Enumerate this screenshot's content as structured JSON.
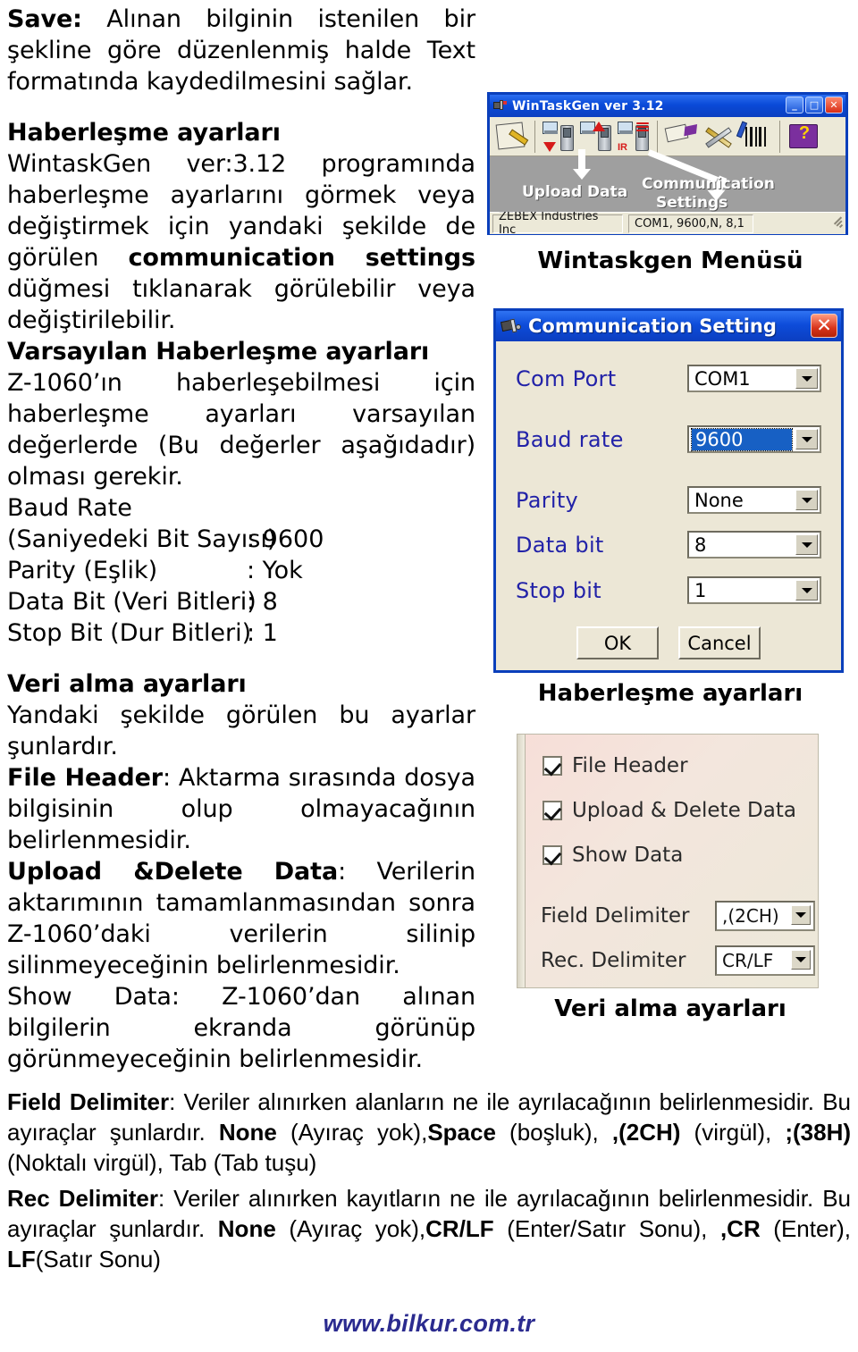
{
  "document": {
    "save_section": {
      "term": "Save:",
      "text": " Alınan bilginin istenilen bir şekline göre düzenlenmiş halde Text formatında kaydedilmesini sağlar."
    },
    "comm_heading": "Haberleşme ayarları",
    "comm_p1_a": "WintaskGen ver:3.12 programında haberleşme ayarlarını görmek veya değiştirmek için yandaki şekilde de görülen ",
    "comm_p1_b": "communication settings",
    "comm_p1_c": " düğmesi tıklanarak görülebilir veya değiştirilebilir.",
    "default_heading": "Varsayılan Haberleşme ayarları",
    "default_p": "Z-1060’ın haberleşebilmesi için haberleşme ayarları varsayılan değerlerde (Bu değerler aşağıdadır) olması gerekir.",
    "spec_lines": [
      {
        "label": "Baud Rate",
        "value": ""
      },
      {
        "label": "(Saniyedeki Bit Sayısı)",
        "value": ": 9600"
      },
      {
        "label": "Parity (Eşlik)",
        "value": ": Yok"
      },
      {
        "label": "Data Bit (Veri Bitleri)",
        "value": ": 8"
      },
      {
        "label": "Stop Bit (Dur Bitleri)",
        "value": ": 1"
      }
    ],
    "rx_heading": "Veri alma ayarları",
    "rx_intro": "Yandaki şekilde görülen bu ayarlar şunlardır.",
    "file_header_term": "File Header",
    "file_header_text": ": Aktarma sırasında dosya bilgisinin olup olmayacağının belirlenmesidir.",
    "upload_delete_term": "Upload &Delete Data",
    "upload_delete_text": ": Verilerin aktarımının tamamlanmasından sonra Z-1060’daki verilerin silinip silinmeyeceğinin belirlenmesidir.",
    "show_data_text": "Show Data: Z-1060’dan alınan bilgilerin ekranda görünüp görünmeyeceğinin belirlenmesidir.",
    "field_delim": {
      "term": "Field Delimiter",
      "t1": ": Veriler alınırken alanların ne ile ayrılacağının belirlenmesidir. Bu ayıraçlar şunlardır. ",
      "b1": "None",
      "t2": " (Ayıraç yok),",
      "b2": "Space",
      "t3": " (boşluk), ",
      "b3": ",(2CH)",
      "t4": " (virgül), ",
      "b4": ";(38H)",
      "t5": " (Noktalı virgül), Tab (Tab tuşu)"
    },
    "rec_delim": {
      "term": "Rec Delimiter",
      "t1": ": Veriler alınırken kayıtların ne ile ayrılacağının belirlenmesidir. Bu ayıraçlar şunlardır. ",
      "b1": "None",
      "t2": " (Ayıraç yok),",
      "b2": "CR/LF",
      "t3": " (Enter/Satır Sonu), ",
      "b3": ",CR",
      "t4": " (Enter), ",
      "b4": "LF",
      "t5": "(Satır Sonu)"
    },
    "footer": "www.bilkur.com.tr",
    "footer_color": "#2b2b8f"
  },
  "captions": {
    "wintaskgen": "Wintaskgen Menüsü",
    "haberlesme": "Haberleşme ayarları",
    "verialma": "Veri alma ayarları"
  },
  "wintaskgen_window": {
    "title": "WinTaskGen ver 3.12",
    "minimize_label": "_",
    "maximize_label": "□",
    "close_label": "✕",
    "annotation_upload": "Upload Data",
    "annotation_comm_line1": "Communication",
    "annotation_comm_line2": "Settings",
    "status_company": "ZEBEX Industries Inc",
    "status_port": "COM1, 9600,N, 8,1",
    "toolbar_icons": [
      "new-document-icon",
      "download-to-device-icon",
      "upload-from-device-icon",
      "ir-transfer-icon",
      "communication-settings-icon",
      "tools-icon",
      "barcode-settings-icon",
      "help-book-icon"
    ]
  },
  "comm_dialog": {
    "title": "Communication Setting",
    "close_label": "✕",
    "fields": [
      {
        "label": "Com Port",
        "value": "COM1",
        "selected": false
      },
      {
        "label": "Baud rate",
        "value": "9600",
        "selected": true
      },
      {
        "label": "Parity",
        "value": "None",
        "selected": false
      },
      {
        "label": "Data bit",
        "value": "8",
        "selected": false
      },
      {
        "label": "Stop bit",
        "value": "1",
        "selected": false
      }
    ],
    "ok_label": "OK",
    "cancel_label": "Cancel"
  },
  "rx_panel": {
    "checkboxes": [
      {
        "label": "File Header",
        "checked": true
      },
      {
        "label": "Upload & Delete Data",
        "checked": true
      },
      {
        "label": "Show Data",
        "checked": true
      }
    ],
    "selects": [
      {
        "label": "Field Delimiter",
        "value": ",(2CH)"
      },
      {
        "label": "Rec. Delimiter",
        "value": "CR/LF"
      }
    ]
  }
}
